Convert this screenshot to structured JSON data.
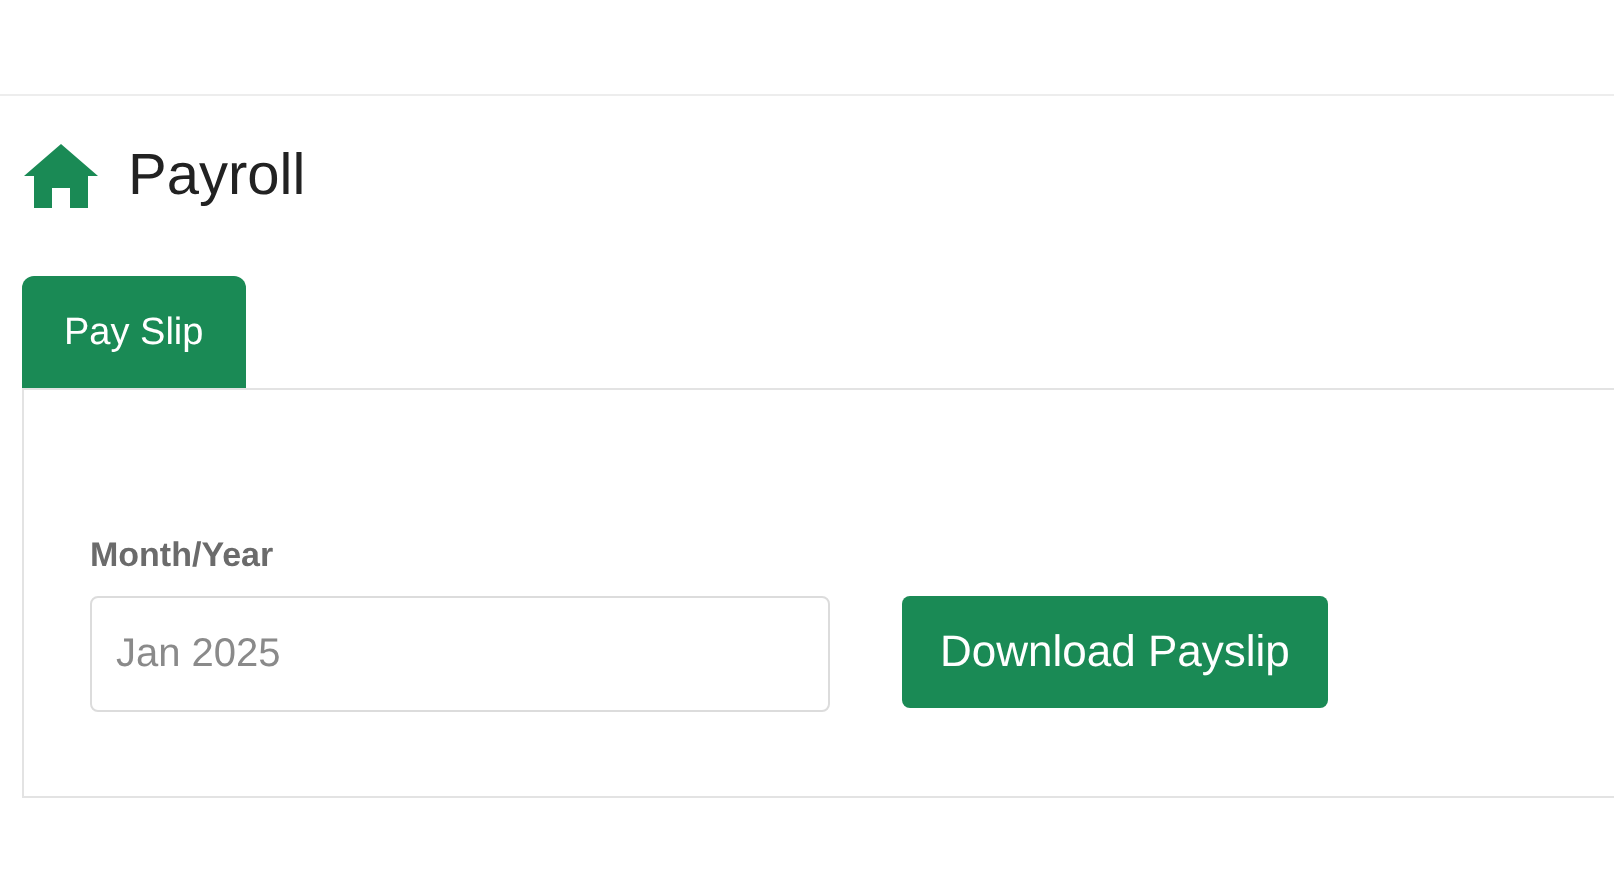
{
  "page": {
    "title": "Payroll"
  },
  "tabs": [
    {
      "label": "Pay Slip",
      "selected": true
    }
  ],
  "form": {
    "month_label": "Month/Year",
    "month_placeholder": "Jan 2025",
    "button": "Download Payslip"
  }
}
